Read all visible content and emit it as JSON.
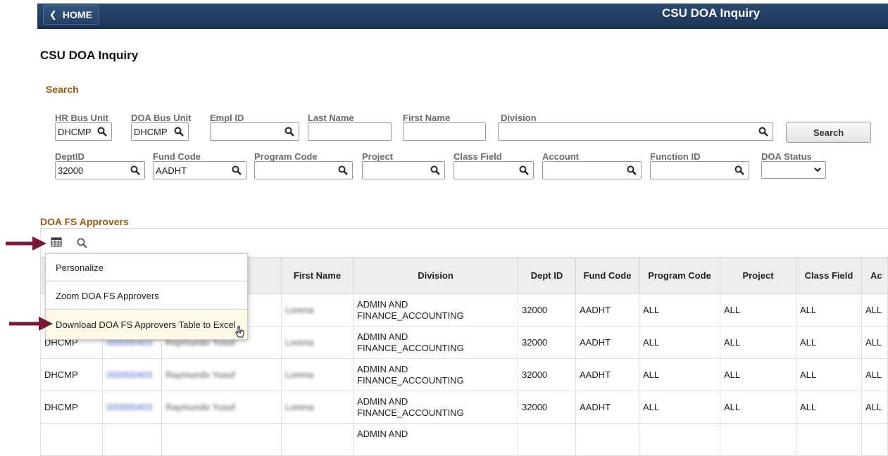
{
  "header": {
    "home_label": "HOME",
    "app_title": "CSU DOA Inquiry"
  },
  "page_title": "CSU DOA Inquiry",
  "search": {
    "heading": "Search",
    "button_label": "Search",
    "fields": {
      "hr_bus_unit": {
        "label": "HR Bus Unit",
        "value": "DHCMP"
      },
      "doa_bus_unit": {
        "label": "DOA Bus Unit",
        "value": "DHCMP"
      },
      "empl_id": {
        "label": "Empl ID",
        "value": ""
      },
      "last_name": {
        "label": "Last Name",
        "value": ""
      },
      "first_name": {
        "label": "First Name",
        "value": ""
      },
      "division": {
        "label": "Division",
        "value": ""
      },
      "dept_id": {
        "label": "DeptID",
        "value": "32000"
      },
      "fund_code": {
        "label": "Fund Code",
        "value": "AADHT"
      },
      "program_code": {
        "label": "Program Code",
        "value": ""
      },
      "project": {
        "label": "Project",
        "value": ""
      },
      "class_field": {
        "label": "Class Field",
        "value": ""
      },
      "account": {
        "label": "Account",
        "value": ""
      },
      "function_id": {
        "label": "Function ID",
        "value": ""
      },
      "doa_status": {
        "label": "DOA Status",
        "value": ""
      }
    }
  },
  "grid": {
    "heading": "DOA FS Approvers",
    "columns": [
      "First Name",
      "Division",
      "Dept ID",
      "Fund Code",
      "Program Code",
      "Project",
      "Class Field",
      "Ac"
    ],
    "rows": [
      {
        "bu": "",
        "empl": "",
        "name": "",
        "first": "Lorena",
        "division": "ADMIN AND FINANCE_ACCOUNTING",
        "dept": "32000",
        "fund": "AADHT",
        "program": "ALL",
        "project": "ALL",
        "class": "ALL",
        "account": "ALL"
      },
      {
        "bu": "DHCMP",
        "empl": "000000403",
        "name": "Raymundo Yusuf",
        "first": "Lorena",
        "division": "ADMIN AND FINANCE_ACCOUNTING",
        "dept": "32000",
        "fund": "AADHT",
        "program": "ALL",
        "project": "ALL",
        "class": "ALL",
        "account": "ALL"
      },
      {
        "bu": "DHCMP",
        "empl": "000000403",
        "name": "Raymundo Yusuf",
        "first": "Lorena",
        "division": "ADMIN AND FINANCE_ACCOUNTING",
        "dept": "32000",
        "fund": "AADHT",
        "program": "ALL",
        "project": "ALL",
        "class": "ALL",
        "account": "ALL"
      },
      {
        "bu": "DHCMP",
        "empl": "000000403",
        "name": "Raymundo Yusuf",
        "first": "Lorena",
        "division": "ADMIN AND FINANCE_ACCOUNTING",
        "dept": "32000",
        "fund": "AADHT",
        "program": "ALL",
        "project": "ALL",
        "class": "ALL",
        "account": "ALL"
      },
      {
        "bu": "",
        "empl": "",
        "name": "",
        "first": "",
        "division": "ADMIN AND",
        "dept": "",
        "fund": "",
        "program": "",
        "project": "",
        "class": "",
        "account": ""
      }
    ]
  },
  "popup_menu": {
    "items": [
      "Personalize",
      "Zoom DOA FS Approvers",
      "Download DOA FS Approvers Table to Excel"
    ]
  },
  "icons": {
    "grid_menu": "grid-settings-icon",
    "grid_search": "search-icon",
    "field_lookup": "search-icon",
    "annotation": "arrow-icon"
  },
  "colors": {
    "header_bg": "#1d3557",
    "section_heading": "#9a5a14",
    "annotation_arrow": "#7a1838",
    "menu_highlight": "#fffbe6"
  }
}
